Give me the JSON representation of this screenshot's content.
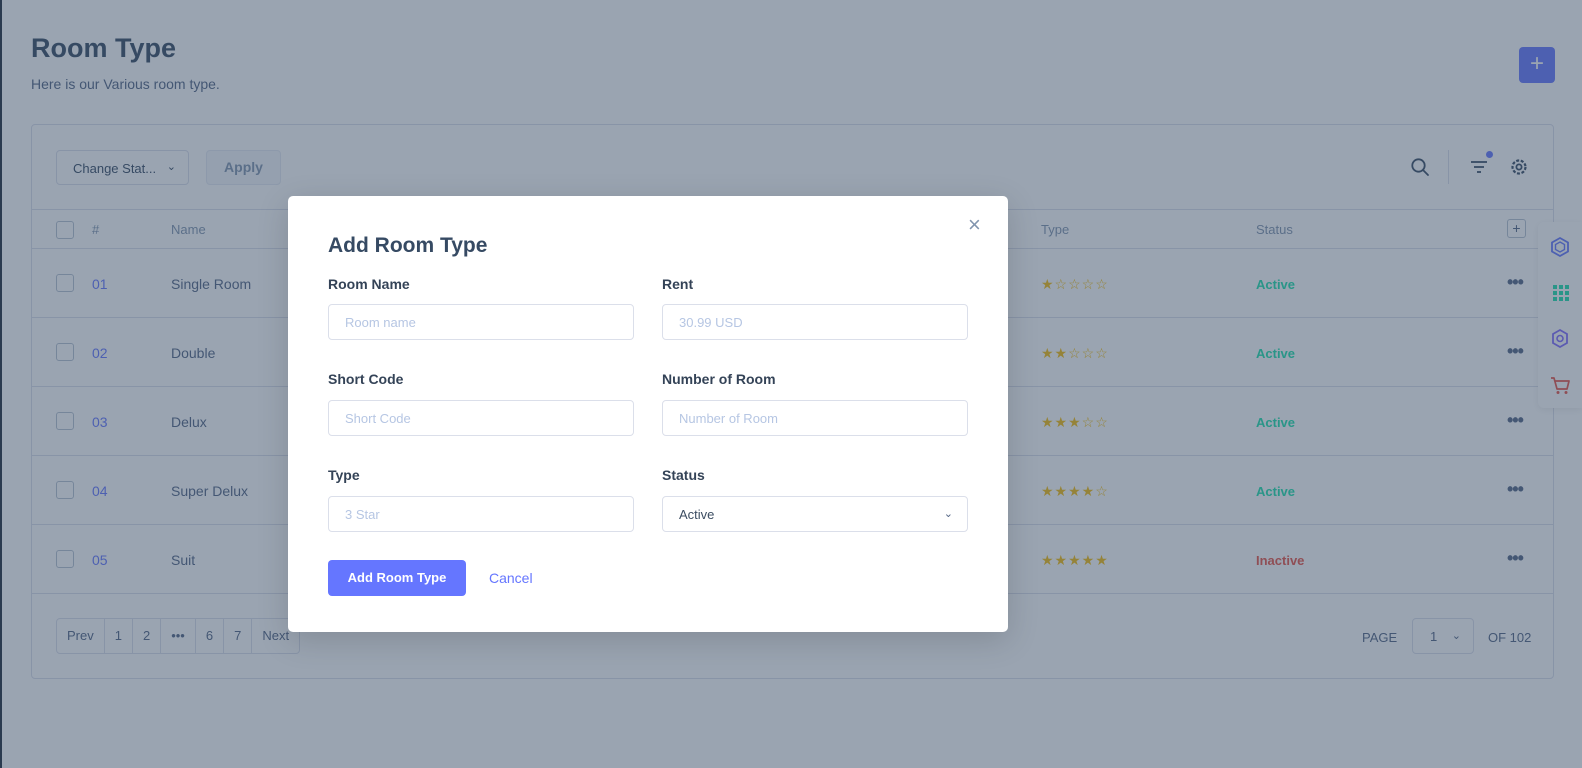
{
  "page": {
    "title": "Room Type",
    "subtitle": "Here is our Various room type.",
    "add_button": "+"
  },
  "toolbar": {
    "bulk_action": "Change Stat...",
    "apply": "Apply",
    "icons": [
      "search-icon",
      "filter-icon",
      "settings-icon"
    ]
  },
  "table": {
    "columns": [
      "#",
      "Name",
      "Type",
      "Status"
    ],
    "rows": [
      {
        "num": "01",
        "name": "Single Room",
        "stars": "★☆☆☆☆",
        "status": "Active"
      },
      {
        "num": "02",
        "name": "Double",
        "stars": "★★☆☆☆",
        "status": "Active"
      },
      {
        "num": "03",
        "name": "Delux",
        "stars": "★★★☆☆",
        "status": "Active"
      },
      {
        "num": "04",
        "name": "Super Delux",
        "stars": "★★★★☆",
        "status": "Active"
      },
      {
        "num": "05",
        "name": "Suit",
        "stars": "★★★★★",
        "status": "Inactive"
      }
    ],
    "more": "•••"
  },
  "pagination": {
    "prev": "Prev",
    "pages": [
      "1",
      "2",
      "•••",
      "6",
      "7"
    ],
    "next": "Next",
    "page_label": "PAGE",
    "current": "1",
    "of_label": "OF 102"
  },
  "modal": {
    "title": "Add Room Type",
    "close": "×",
    "fields": {
      "room_name": {
        "label": "Room Name",
        "placeholder": "Room name"
      },
      "rent": {
        "label": "Rent",
        "placeholder": "30.99 USD"
      },
      "short_code": {
        "label": "Short Code",
        "placeholder": "Short Code"
      },
      "number_of_room": {
        "label": "Number of Room",
        "placeholder": "Number of Room"
      },
      "type": {
        "label": "Type",
        "placeholder": "3 Star"
      },
      "status": {
        "label": "Status",
        "value": "Active"
      }
    },
    "submit": "Add Room Type",
    "cancel": "Cancel"
  },
  "dock_icons": [
    "layers-icon",
    "grid-icon",
    "gear-icon",
    "cart-icon"
  ],
  "colors": {
    "accent": "#6576ff",
    "active": "#1ee0ac",
    "inactive": "#e85347",
    "star": "#f4bd0e"
  }
}
